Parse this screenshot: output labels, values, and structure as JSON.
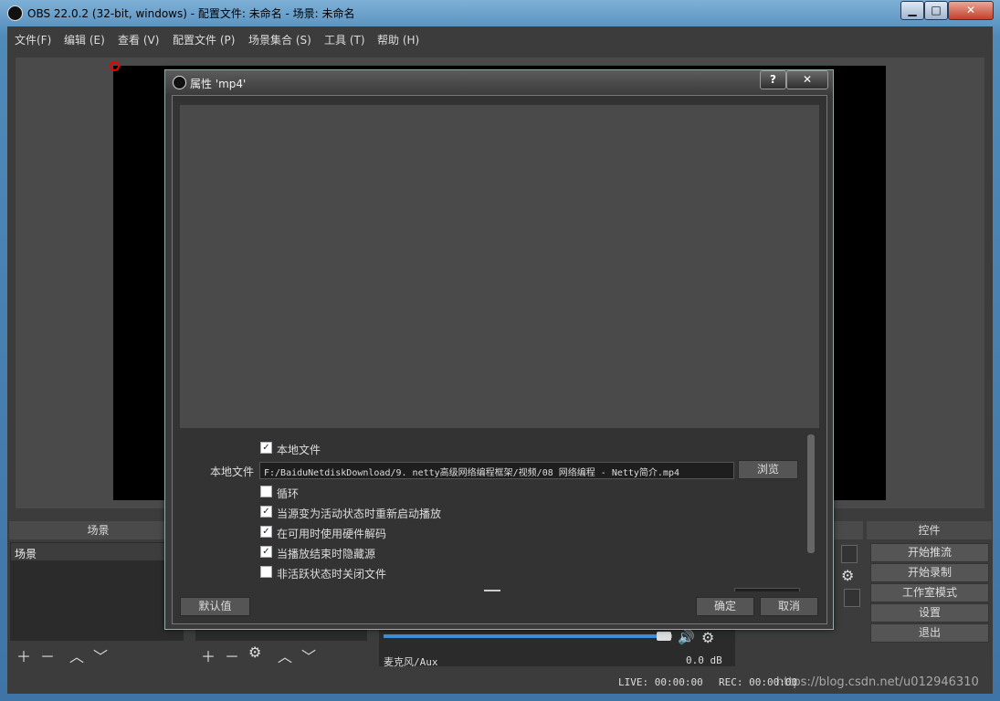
{
  "window": {
    "title": "OBS 22.0.2 (32-bit, windows) - 配置文件: 未命名 - 场景: 未命名",
    "min_glyph": "▁",
    "max_glyph": "□",
    "close_glyph": "✕"
  },
  "menu": [
    "文件(F)",
    "编辑 (E)",
    "查看 (V)",
    "配置文件 (P)",
    "场景集合 (S)",
    "工具 (T)",
    "帮助 (H)"
  ],
  "docks": {
    "scenes_title": "场景",
    "scene_items": [
      "场景"
    ],
    "controls_title": "控件",
    "controls": [
      "开始推流",
      "开始录制",
      "工作室模式",
      "设置",
      "退出"
    ],
    "audio_source": "麦克风/Aux",
    "audio_level": "0.0 dB",
    "audio_volume_fraction": 1.0
  },
  "statusbar": {
    "live": "LIVE: 00:00:00",
    "rec": "REC: 00:00:00",
    "watermark": "https://blog.csdn.net/u012946310"
  },
  "dialog": {
    "title": "属性 'mp4'",
    "help_glyph": "?",
    "close_glyph": "✕",
    "local_file_check": "本地文件",
    "local_file_label": "本地文件",
    "local_file_value": "F:/BaiduNetdiskDownload/9. netty高级网络编程框架/视频/08 网络编程 - Netty简介.mp4",
    "browse": "浏览",
    "options": [
      {
        "label": "循环",
        "checked": false
      },
      {
        "label": "当源变为活动状态时重新启动播放",
        "checked": true
      },
      {
        "label": "在可用时使用硬件解码",
        "checked": true
      },
      {
        "label": "当播放结束时隐藏源",
        "checked": true
      },
      {
        "label": "非活跃状态时关闭文件",
        "checked": false
      }
    ],
    "defaults": "默认值",
    "ok": "确定",
    "cancel": "取消"
  }
}
